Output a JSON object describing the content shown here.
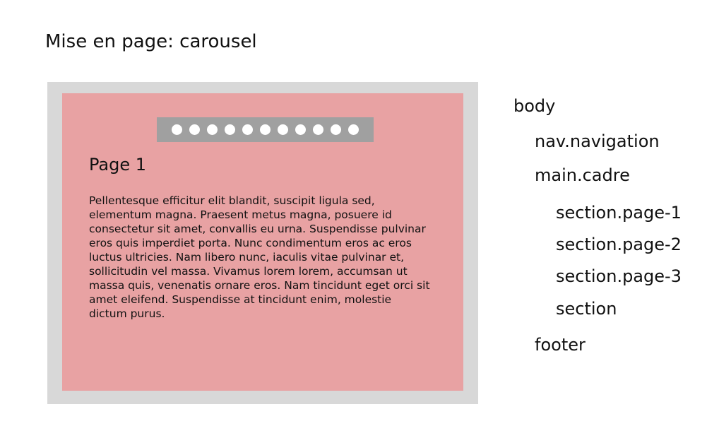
{
  "title": "Mise en page: carousel",
  "carousel": {
    "dot_count": 11,
    "page_title": "Page 1",
    "page_text": "Pellentesque efficitur elit blandit, suscipit ligula sed, elementum magna. Praesent metus magna, posuere id consectetur sit amet, convallis eu urna. Suspendisse pulvinar eros quis imperdiet porta. Nunc condimentum eros ac eros luctus ultricies. Nam libero nunc, iaculis vitae pulvinar et, sollicitudin vel massa. Vivamus lorem lorem, accumsan ut massa quis, venenatis ornare eros. Nam tincidunt eget orci sit amet eleifend. Suspendisse at tincidunt enim, molestie dictum purus."
  },
  "tree": {
    "body": "body",
    "nav": "nav.navigation",
    "main": "main.cadre",
    "section1": "section.page-1",
    "section2": "section.page-2",
    "section3": "section.page-3",
    "section4": "section",
    "footer": "footer"
  },
  "colors": {
    "frame": "#d8d8d8",
    "cadre": "#e8a2a3",
    "nav": "#a0a0a0",
    "dot": "#ffffff"
  }
}
